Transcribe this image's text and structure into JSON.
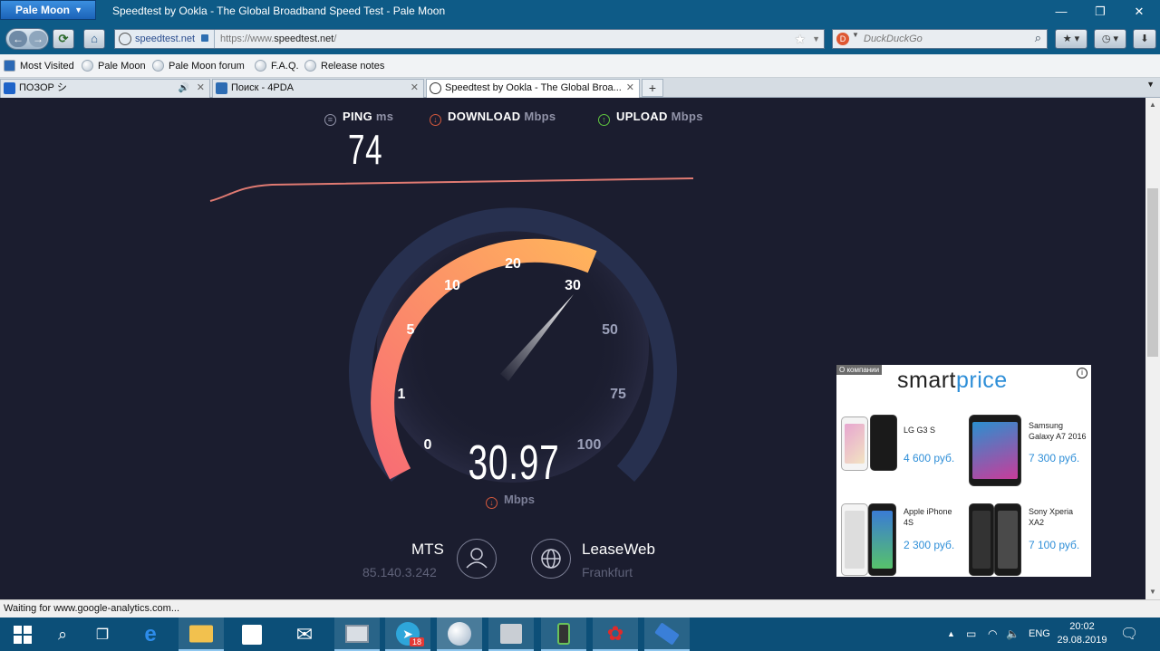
{
  "window": {
    "app_menu": "Pale Moon",
    "title": "Speedtest by Ookla - The Global Broadband Speed Test - Pale Moon",
    "minimize": "—",
    "maximize": "❐",
    "close": "✕"
  },
  "nav": {
    "identity": "speedtest.net",
    "url_prefix": "https://www.",
    "url_domain": "speedtest.net",
    "url_suffix": "/",
    "search_engine": "DuckDuckGo"
  },
  "bookmarks": [
    "Most Visited",
    "Pale Moon",
    "Pale Moon forum",
    "F.A.Q.",
    "Release notes"
  ],
  "tabs": [
    {
      "label": "ПОЗОР シ",
      "active": false,
      "audio": true
    },
    {
      "label": "Поиск - 4PDA",
      "active": false,
      "audio": false
    },
    {
      "label": "Speedtest by Ookla - The Global Broa...",
      "active": true,
      "audio": false
    }
  ],
  "speedtest": {
    "ping": {
      "label": "PING",
      "unit": "ms",
      "value": "74"
    },
    "download": {
      "label": "DOWNLOAD",
      "unit": "Mbps"
    },
    "upload": {
      "label": "UPLOAD",
      "unit": "Mbps"
    },
    "gauge": {
      "ticks": [
        "0",
        "1",
        "5",
        "10",
        "20",
        "30",
        "50",
        "75",
        "100"
      ],
      "current_value": "30.97",
      "unit": "Mbps",
      "accent_start": "#f86d74",
      "accent_end": "#ffb35c",
      "track_color": "#27304f"
    },
    "isp": {
      "name": "MTS",
      "ip": "85.140.3.242"
    },
    "server": {
      "name": "LeaseWeb",
      "location": "Frankfurt"
    }
  },
  "ad": {
    "tag": "О компании",
    "logo_a": "smart",
    "logo_b": "price",
    "items": [
      {
        "name": "LG G3 S",
        "price": "4 600 руб."
      },
      {
        "name": "Samsung Galaxy A7 2016",
        "price": "7 300 руб."
      },
      {
        "name": "Apple iPhone 4S",
        "price": "2 300 руб."
      },
      {
        "name": "Sony Xperia XA2",
        "price": "7 100 руб."
      }
    ]
  },
  "status": "Waiting for www.google-analytics.com...",
  "taskbar": {
    "telegram_badge": "18",
    "lang": "ENG",
    "time": "20:02",
    "date": "29.08.2019"
  }
}
